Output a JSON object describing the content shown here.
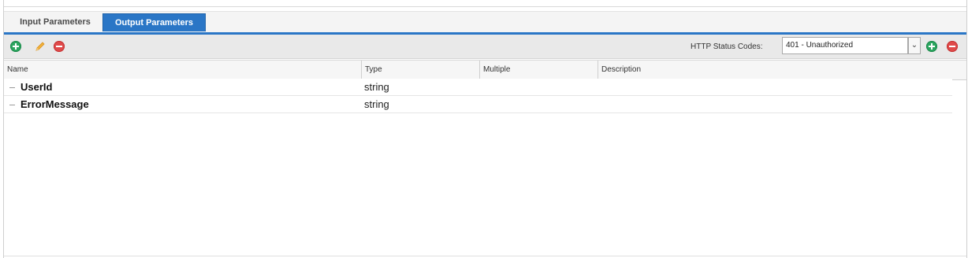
{
  "tabs": [
    {
      "label": "Input Parameters",
      "active": false
    },
    {
      "label": "Output Parameters",
      "active": true
    }
  ],
  "toolbar": {
    "buttons": [
      {
        "icon": "add-icon",
        "color": "#2ba55f"
      },
      {
        "icon": "edit-pencil-icon",
        "color": "#f0a020"
      },
      {
        "icon": "remove-icon",
        "color": "#e04a4a"
      }
    ],
    "status_label": "HTTP Status Codes:",
    "status_value": "401 - Unauthorized",
    "right_buttons": [
      {
        "icon": "add-status-icon",
        "color": "#2ba55f"
      },
      {
        "icon": "remove-status-icon",
        "color": "#e04a4a"
      }
    ]
  },
  "grid": {
    "columns": [
      "Name",
      "Type",
      "Multiple",
      "Description"
    ],
    "rows": [
      {
        "name": "UserId",
        "type": "string",
        "multiple": "",
        "description": ""
      },
      {
        "name": "ErrorMessage",
        "type": "string",
        "multiple": "",
        "description": ""
      }
    ]
  },
  "colors": {
    "accent": "#2a76c6",
    "toolbar_bg": "#e9e9e9",
    "header_bg": "#f6f6f6"
  }
}
